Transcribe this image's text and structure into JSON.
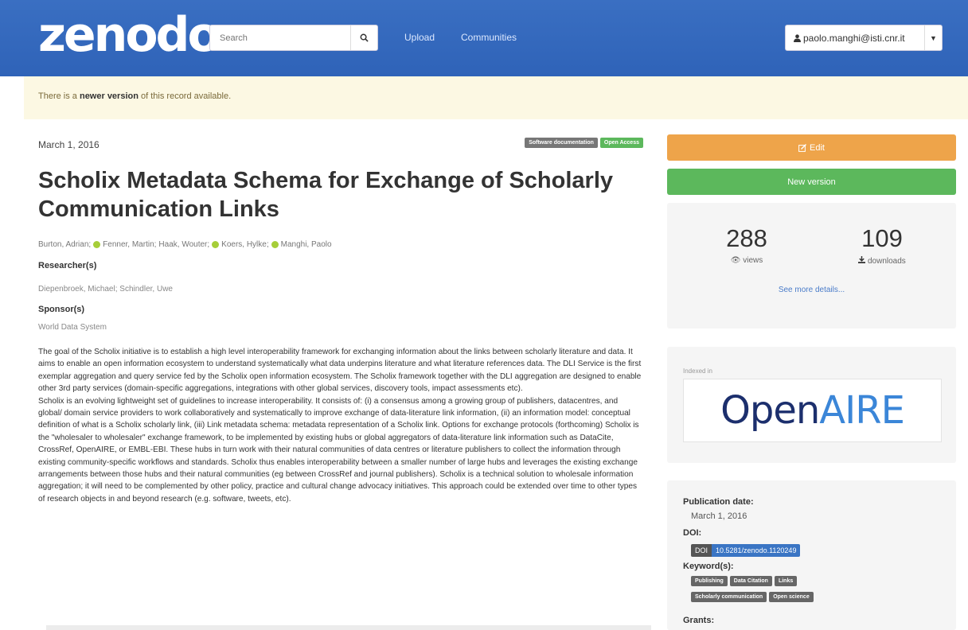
{
  "navbar": {
    "logo": "zenodo",
    "search_placeholder": "Search",
    "links": [
      "Upload",
      "Communities"
    ],
    "user": "paolo.manghi@isti.cnr.it"
  },
  "alert": {
    "prefix": "There is a ",
    "bold": "newer version",
    "suffix": " of this record available."
  },
  "record": {
    "date": "March 1, 2016",
    "badges": [
      "Software documentation",
      "Open Access"
    ],
    "title": "Scholix Metadata Schema for Exchange of Scholarly Communication Links",
    "authors": [
      "Burton, Adrian;",
      "Fenner, Martin;",
      "Haak, Wouter;",
      "Koers, Hylke;",
      "Manghi, Paolo"
    ],
    "researchers_label": "Researcher(s)",
    "researchers": "Diepenbroek, Michael; Schindler, Uwe",
    "sponsors_label": "Sponsor(s)",
    "sponsors": "World Data System",
    "description_1": "The goal of the Scholix initiative is to establish a high level interoperability framework for exchanging information about the links between scholarly literature and data. It aims to enable an open information ecosystem to understand systematically what data underpins literature and what literature references data. The DLI Service is the first exemplar aggregation and query service fed by the Scholix open information ecosystem. The Scholix framework together with the DLI aggregation are designed to enable other 3rd party services (domain-specific aggregations, integrations with other global services, discovery tools, impact assessments etc).",
    "description_2": "Scholix is an evolving lightweight set of guidelines to increase interoperability. It consists of: (i) a consensus among a growing group of publishers, datacentres, and global/ domain service providers to work collaboratively and systematically to improve exchange of data-literature link information, (ii) an information model: conceptual definition of what is a Scholix scholarly link, (iii) Link metadata schema: metadata representation of a Scholix link. Options for exchange protocols (forthcoming) Scholix is the \"wholesaler to wholesaler\" exchange framework, to be implemented by existing hubs or global aggregators of data-literature link information such as DataCite, CrossRef, OpenAIRE, or EMBL-EBI. These hubs in turn work with their natural communities of data centres or literature publishers to collect the information through existing community-specific workflows and standards. Scholix thus enables interoperability between a smaller number of large hubs and leverages the existing exchange arrangements between those hubs and their natural communities (eg between CrossRef and journal publishers). Scholix is a technical solution to wholesale information aggregation; it will need to be complemented by other policy, practice and cultural change advocacy initiatives. This approach could be extended over time to other types of research objects in and beyond research (e.g. software, tweets, etc)."
  },
  "sidebar": {
    "edit_label": "Edit",
    "new_version_label": "New version",
    "views_count": "288",
    "views_label": "views",
    "downloads_count": "109",
    "downloads_label": "downloads",
    "more_details": "See more details...",
    "indexed_in": "Indexed in",
    "openaire_part1": "Open",
    "openaire_part2": "AIRE",
    "pub_date_label": "Publication date:",
    "pub_date": "March 1, 2016",
    "doi_label": "DOI:",
    "doi_key": "DOI",
    "doi_value": "10.5281/zenodo.1120249",
    "keywords_label": "Keyword(s):",
    "keywords_row1": [
      "Publishing",
      "Data Citation",
      "Links"
    ],
    "keywords_row2": [
      "Scholarly communication",
      "Open science"
    ],
    "grants_label": "Grants:"
  },
  "colors": {
    "navbar": "#3a6fc2",
    "edit": "#eea44a",
    "new_version": "#5cb85c",
    "link": "#4a7cc9"
  }
}
